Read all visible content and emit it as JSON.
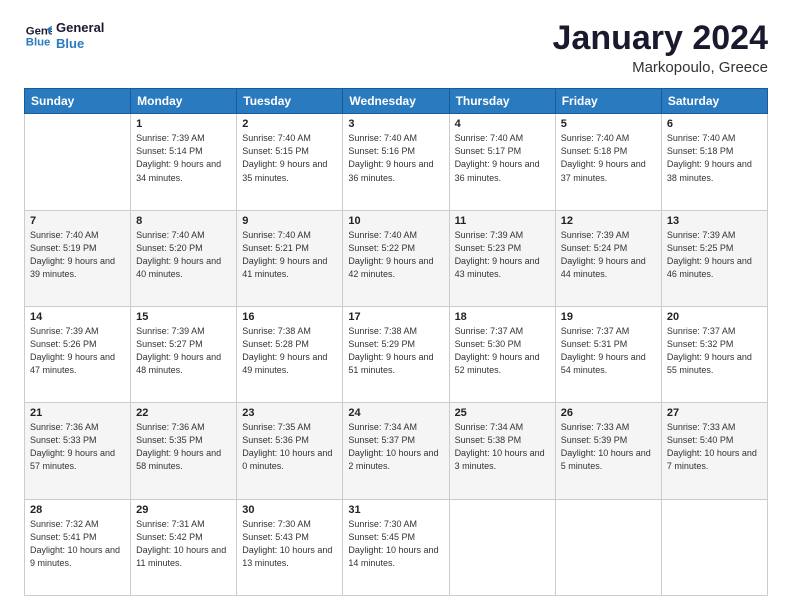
{
  "header": {
    "logo_line1": "General",
    "logo_line2": "Blue",
    "title": "January 2024",
    "subtitle": "Markopoulo, Greece"
  },
  "days_of_week": [
    "Sunday",
    "Monday",
    "Tuesday",
    "Wednesday",
    "Thursday",
    "Friday",
    "Saturday"
  ],
  "weeks": [
    [
      {
        "day": "",
        "sunrise": "",
        "sunset": "",
        "daylight": ""
      },
      {
        "day": "1",
        "sunrise": "Sunrise: 7:39 AM",
        "sunset": "Sunset: 5:14 PM",
        "daylight": "Daylight: 9 hours and 34 minutes."
      },
      {
        "day": "2",
        "sunrise": "Sunrise: 7:40 AM",
        "sunset": "Sunset: 5:15 PM",
        "daylight": "Daylight: 9 hours and 35 minutes."
      },
      {
        "day": "3",
        "sunrise": "Sunrise: 7:40 AM",
        "sunset": "Sunset: 5:16 PM",
        "daylight": "Daylight: 9 hours and 36 minutes."
      },
      {
        "day": "4",
        "sunrise": "Sunrise: 7:40 AM",
        "sunset": "Sunset: 5:17 PM",
        "daylight": "Daylight: 9 hours and 36 minutes."
      },
      {
        "day": "5",
        "sunrise": "Sunrise: 7:40 AM",
        "sunset": "Sunset: 5:18 PM",
        "daylight": "Daylight: 9 hours and 37 minutes."
      },
      {
        "day": "6",
        "sunrise": "Sunrise: 7:40 AM",
        "sunset": "Sunset: 5:18 PM",
        "daylight": "Daylight: 9 hours and 38 minutes."
      }
    ],
    [
      {
        "day": "7",
        "sunrise": "Sunrise: 7:40 AM",
        "sunset": "Sunset: 5:19 PM",
        "daylight": "Daylight: 9 hours and 39 minutes."
      },
      {
        "day": "8",
        "sunrise": "Sunrise: 7:40 AM",
        "sunset": "Sunset: 5:20 PM",
        "daylight": "Daylight: 9 hours and 40 minutes."
      },
      {
        "day": "9",
        "sunrise": "Sunrise: 7:40 AM",
        "sunset": "Sunset: 5:21 PM",
        "daylight": "Daylight: 9 hours and 41 minutes."
      },
      {
        "day": "10",
        "sunrise": "Sunrise: 7:40 AM",
        "sunset": "Sunset: 5:22 PM",
        "daylight": "Daylight: 9 hours and 42 minutes."
      },
      {
        "day": "11",
        "sunrise": "Sunrise: 7:39 AM",
        "sunset": "Sunset: 5:23 PM",
        "daylight": "Daylight: 9 hours and 43 minutes."
      },
      {
        "day": "12",
        "sunrise": "Sunrise: 7:39 AM",
        "sunset": "Sunset: 5:24 PM",
        "daylight": "Daylight: 9 hours and 44 minutes."
      },
      {
        "day": "13",
        "sunrise": "Sunrise: 7:39 AM",
        "sunset": "Sunset: 5:25 PM",
        "daylight": "Daylight: 9 hours and 46 minutes."
      }
    ],
    [
      {
        "day": "14",
        "sunrise": "Sunrise: 7:39 AM",
        "sunset": "Sunset: 5:26 PM",
        "daylight": "Daylight: 9 hours and 47 minutes."
      },
      {
        "day": "15",
        "sunrise": "Sunrise: 7:39 AM",
        "sunset": "Sunset: 5:27 PM",
        "daylight": "Daylight: 9 hours and 48 minutes."
      },
      {
        "day": "16",
        "sunrise": "Sunrise: 7:38 AM",
        "sunset": "Sunset: 5:28 PM",
        "daylight": "Daylight: 9 hours and 49 minutes."
      },
      {
        "day": "17",
        "sunrise": "Sunrise: 7:38 AM",
        "sunset": "Sunset: 5:29 PM",
        "daylight": "Daylight: 9 hours and 51 minutes."
      },
      {
        "day": "18",
        "sunrise": "Sunrise: 7:37 AM",
        "sunset": "Sunset: 5:30 PM",
        "daylight": "Daylight: 9 hours and 52 minutes."
      },
      {
        "day": "19",
        "sunrise": "Sunrise: 7:37 AM",
        "sunset": "Sunset: 5:31 PM",
        "daylight": "Daylight: 9 hours and 54 minutes."
      },
      {
        "day": "20",
        "sunrise": "Sunrise: 7:37 AM",
        "sunset": "Sunset: 5:32 PM",
        "daylight": "Daylight: 9 hours and 55 minutes."
      }
    ],
    [
      {
        "day": "21",
        "sunrise": "Sunrise: 7:36 AM",
        "sunset": "Sunset: 5:33 PM",
        "daylight": "Daylight: 9 hours and 57 minutes."
      },
      {
        "day": "22",
        "sunrise": "Sunrise: 7:36 AM",
        "sunset": "Sunset: 5:35 PM",
        "daylight": "Daylight: 9 hours and 58 minutes."
      },
      {
        "day": "23",
        "sunrise": "Sunrise: 7:35 AM",
        "sunset": "Sunset: 5:36 PM",
        "daylight": "Daylight: 10 hours and 0 minutes."
      },
      {
        "day": "24",
        "sunrise": "Sunrise: 7:34 AM",
        "sunset": "Sunset: 5:37 PM",
        "daylight": "Daylight: 10 hours and 2 minutes."
      },
      {
        "day": "25",
        "sunrise": "Sunrise: 7:34 AM",
        "sunset": "Sunset: 5:38 PM",
        "daylight": "Daylight: 10 hours and 3 minutes."
      },
      {
        "day": "26",
        "sunrise": "Sunrise: 7:33 AM",
        "sunset": "Sunset: 5:39 PM",
        "daylight": "Daylight: 10 hours and 5 minutes."
      },
      {
        "day": "27",
        "sunrise": "Sunrise: 7:33 AM",
        "sunset": "Sunset: 5:40 PM",
        "daylight": "Daylight: 10 hours and 7 minutes."
      }
    ],
    [
      {
        "day": "28",
        "sunrise": "Sunrise: 7:32 AM",
        "sunset": "Sunset: 5:41 PM",
        "daylight": "Daylight: 10 hours and 9 minutes."
      },
      {
        "day": "29",
        "sunrise": "Sunrise: 7:31 AM",
        "sunset": "Sunset: 5:42 PM",
        "daylight": "Daylight: 10 hours and 11 minutes."
      },
      {
        "day": "30",
        "sunrise": "Sunrise: 7:30 AM",
        "sunset": "Sunset: 5:43 PM",
        "daylight": "Daylight: 10 hours and 13 minutes."
      },
      {
        "day": "31",
        "sunrise": "Sunrise: 7:30 AM",
        "sunset": "Sunset: 5:45 PM",
        "daylight": "Daylight: 10 hours and 14 minutes."
      },
      {
        "day": "",
        "sunrise": "",
        "sunset": "",
        "daylight": ""
      },
      {
        "day": "",
        "sunrise": "",
        "sunset": "",
        "daylight": ""
      },
      {
        "day": "",
        "sunrise": "",
        "sunset": "",
        "daylight": ""
      }
    ]
  ]
}
